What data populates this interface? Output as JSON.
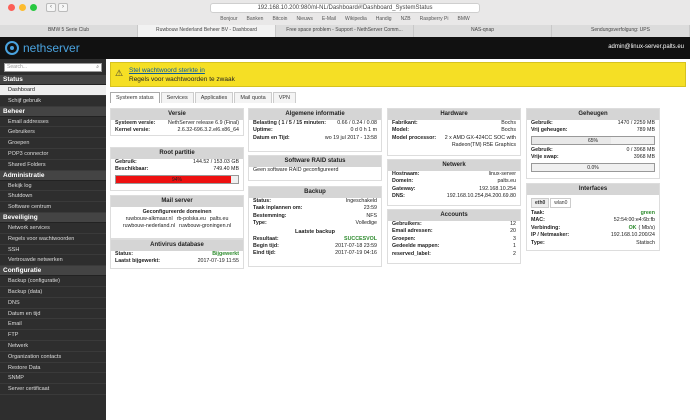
{
  "browser": {
    "url": "192.168.10.200:980/nl-NL/Dashboard#!Dashboard_SystemStatus",
    "bookmarks": [
      "Bonjour",
      "Banken",
      "Bitcoin",
      "Nieuws",
      "E-Mail",
      "Wikipedia",
      "Handig",
      "NZB",
      "Raspberry Pi",
      "BMW"
    ],
    "tabs": [
      "BMW 5 Serie Club",
      "Ruwbouw Nederland Beheer BV - Dashboard",
      "Free space problem - Support - NethServer Comm...",
      "NAS-qnap",
      "Sendungsverfolgung: UPS"
    ]
  },
  "header": {
    "brand": "nethserver",
    "user": "admin@linux-server.palts.eu"
  },
  "sidebar": {
    "search_placeholder": "Search...",
    "sections": [
      {
        "title": "Status",
        "items": [
          "Dashboard",
          "Schijf gebruik"
        ]
      },
      {
        "title": "Beheer",
        "items": [
          "Email addresses",
          "Gebruikers",
          "Groepen",
          "POP3 connector",
          "Shared Folders"
        ]
      },
      {
        "title": "Administratie",
        "items": [
          "Bekijk log",
          "Shutdown",
          "Software centrum"
        ]
      },
      {
        "title": "Beveiliging",
        "items": [
          "Network services",
          "Regels voor wachtwoorden",
          "SSH",
          "Vertrouwde netwerken"
        ]
      },
      {
        "title": "Configuratie",
        "items": [
          "Backup (configuratie)",
          "Backup (data)",
          "DNS",
          "Datum en tijd",
          "Email",
          "FTP",
          "Netwerk",
          "Organization contacts",
          "Restore Data",
          "SNMP",
          "Server certificaat"
        ]
      }
    ]
  },
  "alert": {
    "line1": "Stel wachtwoord sterkte in",
    "line2": "Regels voor wachtwoorden te zwaak"
  },
  "content_tabs": [
    "Systeem status",
    "Services",
    "Applicaties",
    "Mail quota",
    "VPN"
  ],
  "versie": {
    "title": "Versie",
    "rows": [
      {
        "k": "Systeem versie:",
        "v": "NethServer release 6.9 (Final)"
      },
      {
        "k": "Kernel versie:",
        "v": "2.6.32-696.3.2.el6.x86_64"
      }
    ]
  },
  "root": {
    "title": "Root partitie",
    "rows": [
      {
        "k": "Gebruik:",
        "v": "144.52 / 153.03 GB"
      },
      {
        "k": "Beschikbaar:",
        "v": "749.40 MB"
      }
    ],
    "bar_label": "94%",
    "bar_value": 94
  },
  "mail": {
    "title": "Mail server",
    "heading": "Geconfigureerde domeinen",
    "domains": [
      [
        "ruwbouw-alkmaar.nl",
        "rb-polska.eu",
        "palts.eu"
      ],
      [
        "ruwbouw-nederland.nl",
        "ruwbouw-groningen.nl"
      ]
    ]
  },
  "antivirus": {
    "title": "Antivirus database",
    "rows": [
      {
        "k": "Status:",
        "v": "Bijgewerkt"
      },
      {
        "k": "Laatst bijgewerkt:",
        "v": "2017-07-19 11:55"
      }
    ]
  },
  "algemeen": {
    "title": "Algemene informatie",
    "rows": [
      {
        "k": "Belasting ( 1 / 5 / 15 minuten:",
        "v": "0.66 / 0.24 / 0.08"
      },
      {
        "k": "Uptime:",
        "v": "0 d 0 h 1 m"
      },
      {
        "k": "Datum en Tijd:",
        "v": "wo 19 jul 2017 - 13:58"
      }
    ]
  },
  "raid": {
    "title": "Software RAID status",
    "text": "Geen software RAID geconfigureerd"
  },
  "backup": {
    "title": "Backup",
    "rows": [
      {
        "k": "Status:",
        "v": "Ingeschakeld"
      },
      {
        "k": "Taak inplannen om:",
        "v": "23:59"
      },
      {
        "k": "Bestemming:",
        "v": "NFS"
      },
      {
        "k": "Type:",
        "v": "Volledige"
      }
    ],
    "last_heading": "Laatste backup",
    "last_rows": [
      {
        "k": "Resultaat:",
        "v": "SUCCESVOL"
      },
      {
        "k": "Begin tijd:",
        "v": "2017-07-18 23:59"
      },
      {
        "k": "Eind tijd:",
        "v": "2017-07-19 04:16"
      }
    ]
  },
  "hardware": {
    "title": "Hardware",
    "rows": [
      {
        "k": "Fabrikant:",
        "v": "Bochs"
      },
      {
        "k": "Model:",
        "v": "Bochs"
      },
      {
        "k": "Model processor:",
        "v": "2 x AMD GX-424CC SOC with"
      },
      {
        "k": "",
        "v": "Radeon(TM) R5E Graphics"
      }
    ]
  },
  "netwerk": {
    "title": "Netwerk",
    "rows": [
      {
        "k": "Hostnaam:",
        "v": "linux-server"
      },
      {
        "k": "Domein:",
        "v": "palts.eu"
      },
      {
        "k": "Gateway:",
        "v": "192.168.10.254"
      },
      {
        "k": "DNS:",
        "v": "192.168.10.254,84.200.69.80"
      }
    ]
  },
  "accounts": {
    "title": "Accounts",
    "rows": [
      {
        "k": "Gebruikers:",
        "v": "12"
      },
      {
        "k": "Email adressen:",
        "v": "20"
      },
      {
        "k": "Groepen:",
        "v": "3"
      },
      {
        "k": "Gedeelde mappen:",
        "v": "1"
      },
      {
        "k": "reserved_label:",
        "v": "2"
      }
    ]
  },
  "geheugen": {
    "title": "Geheugen",
    "rows1": [
      {
        "k": "Gebruik:",
        "v": "1470 / 2259 MB"
      },
      {
        "k": "Vrij geheugen:",
        "v": "789 MB"
      }
    ],
    "bar1_label": "65%",
    "bar1_value": 65,
    "rows2": [
      {
        "k": "Gebruik:",
        "v": "0 / 3968 MB"
      },
      {
        "k": "Vrije swap:",
        "v": "3968 MB"
      }
    ],
    "bar2_label": "0.0%",
    "bar2_value": 0
  },
  "interfaces": {
    "title": "Interfaces",
    "tabs": [
      "eth0",
      "wlan0"
    ],
    "rows": [
      {
        "k": "Taak:",
        "v": "green"
      },
      {
        "k": "MAC:",
        "v": "52:54:00:e4:6b:fb"
      },
      {
        "k": "Verbinding:",
        "v": "OK",
        "v2": "( Mb/s)"
      },
      {
        "k": "IP / Netmasker:",
        "v": "192.168.10.200/24"
      },
      {
        "k": "Type:",
        "v": "Statisch"
      }
    ]
  },
  "colors": {
    "alert": "#f5df25",
    "danger_bar": "#ee1111",
    "ok": "#2c8a2c",
    "brand": "#4aa3df"
  }
}
